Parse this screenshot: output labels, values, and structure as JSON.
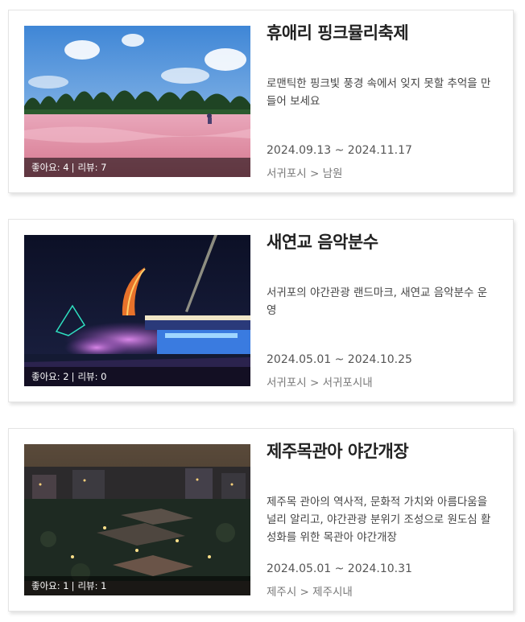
{
  "festivals": [
    {
      "title": "휴애리 핑크뮬리축제",
      "description": "로맨틱한 핑크빛 풍경 속에서 잊지 못할 추억을 만들어 보세요",
      "date": "2024.09.13 ~ 2024.11.17",
      "region": "서귀포시 > 남원",
      "likes": "좋아요: 4",
      "reviews": "리뷰: 7"
    },
    {
      "title": "새연교 음악분수",
      "description": "서귀포의 야간관광 랜드마크, 새연교 음악분수 운영",
      "date": "2024.05.01 ~ 2024.10.25",
      "region": "서귀포시 > 서귀포시내",
      "likes": "좋아요: 2",
      "reviews": "리뷰: 0"
    },
    {
      "title": "제주목관아 야간개장",
      "description": "제주목 관아의 역사적, 문화적 가치와 아름다움을 널리 알리고, 야간관광 분위기 조성으로 원도심 활성화를 위한 목관아 야간개장",
      "date": "2024.05.01 ~ 2024.10.31",
      "region": "제주시 > 제주시내",
      "likes": "좋아요: 1",
      "reviews": "리뷰: 1"
    }
  ],
  "stat_separator": "|",
  "colors": {
    "title": "#222222",
    "text": "#444444",
    "meta": "#777777",
    "stats_bar": "rgba(0,0,0,0.55)"
  }
}
